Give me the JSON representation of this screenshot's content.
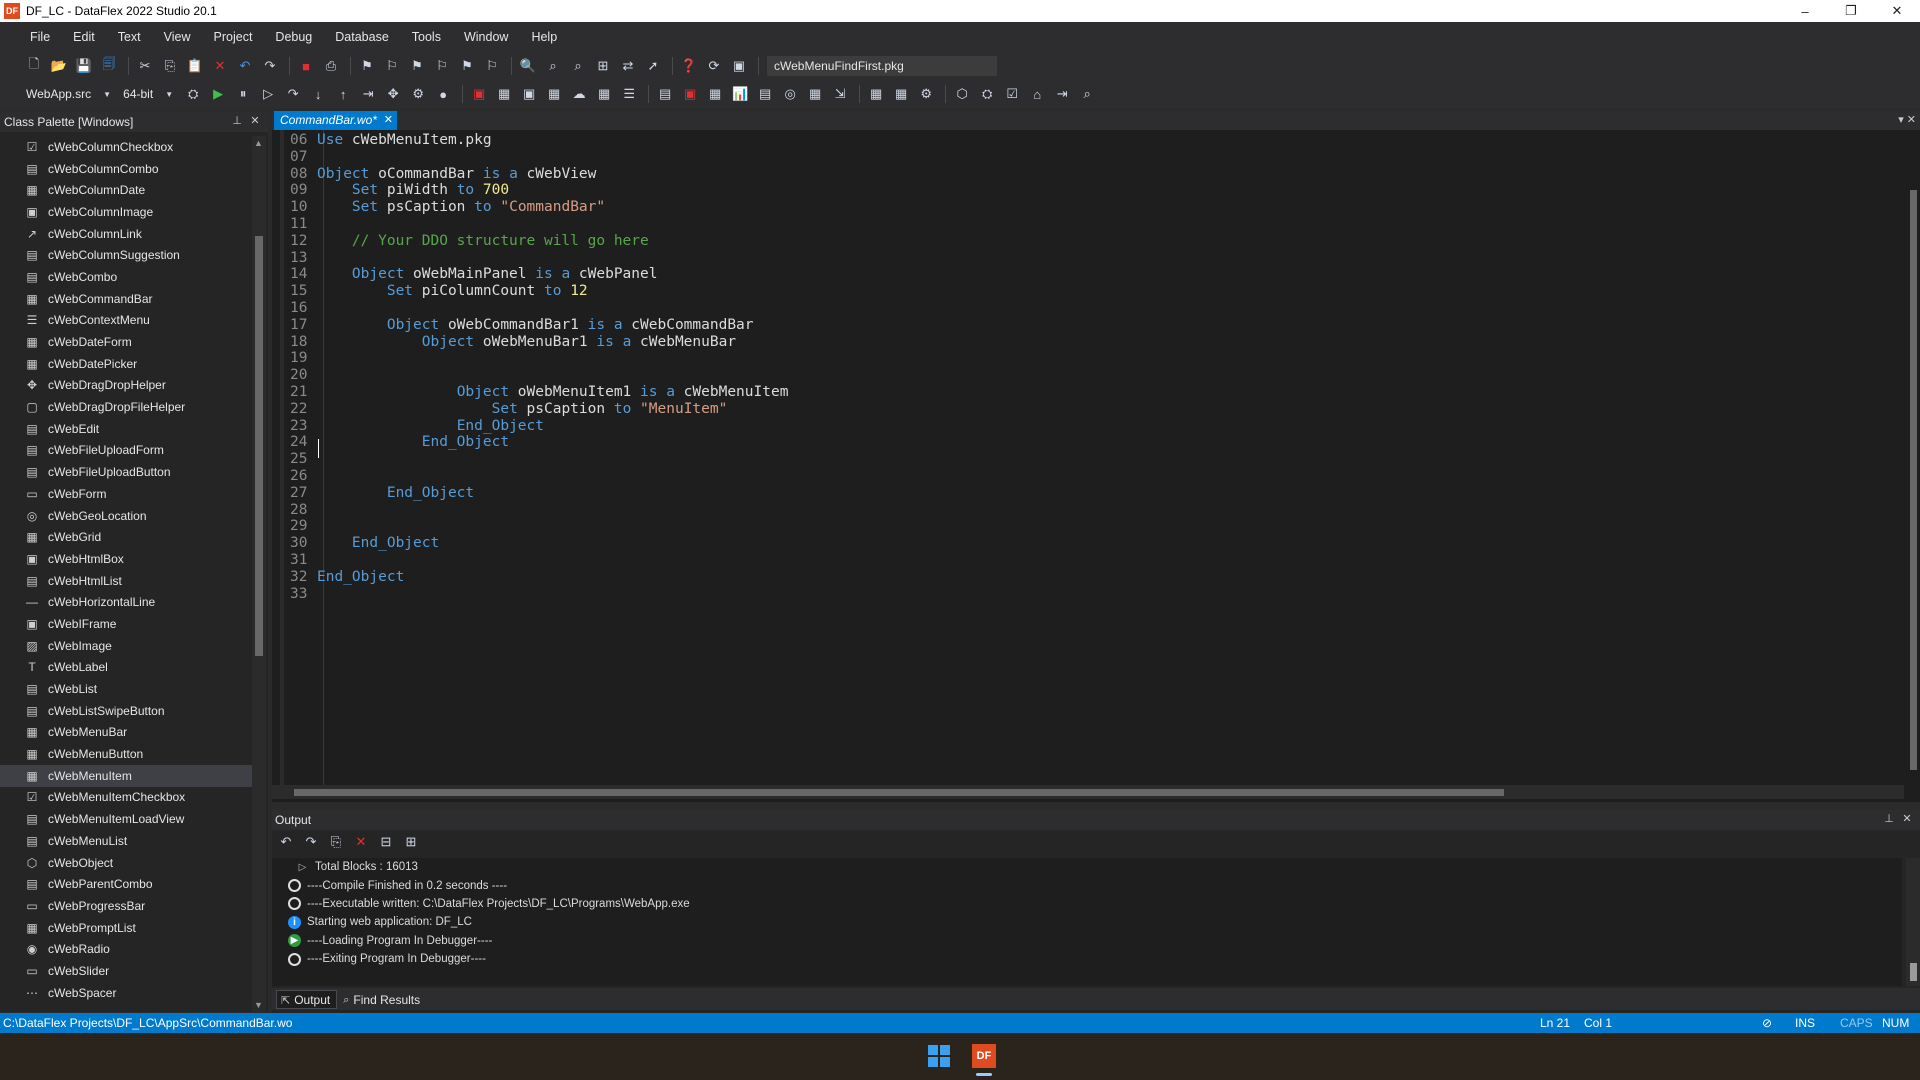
{
  "window": {
    "title": "DF_LC - DataFlex 2022 Studio 20.1",
    "app_icon": "DF",
    "controls": {
      "minimize": "–",
      "maximize": "❐",
      "close": "✕"
    }
  },
  "menu": [
    "File",
    "Edit",
    "Text",
    "View",
    "Project",
    "Debug",
    "Database",
    "Tools",
    "Window",
    "Help"
  ],
  "toolbar": {
    "search_combo_value": "cWebMenuFindFirst.pkg",
    "project_selector": "WebApp.src",
    "bitness_selector": "64-bit"
  },
  "class_palette": {
    "title": "Class Palette [Windows]",
    "selected_index": 29,
    "items": [
      {
        "label": "cWebColumnCheckbox",
        "icon": "☑"
      },
      {
        "label": "cWebColumnCombo",
        "icon": "▤"
      },
      {
        "label": "cWebColumnDate",
        "icon": "▦"
      },
      {
        "label": "cWebColumnImage",
        "icon": "▣"
      },
      {
        "label": "cWebColumnLink",
        "icon": "↗"
      },
      {
        "label": "cWebColumnSuggestion",
        "icon": "▤"
      },
      {
        "label": "cWebCombo",
        "icon": "▤"
      },
      {
        "label": "cWebCommandBar",
        "icon": "▦"
      },
      {
        "label": "cWebContextMenu",
        "icon": "☰"
      },
      {
        "label": "cWebDateForm",
        "icon": "▦"
      },
      {
        "label": "cWebDatePicker",
        "icon": "▦"
      },
      {
        "label": "cWebDragDropHelper",
        "icon": "✥"
      },
      {
        "label": "cWebDragDropFileHelper",
        "icon": "▢"
      },
      {
        "label": "cWebEdit",
        "icon": "▤"
      },
      {
        "label": "cWebFileUploadForm",
        "icon": "▤"
      },
      {
        "label": "cWebFileUploadButton",
        "icon": "▤"
      },
      {
        "label": "cWebForm",
        "icon": "▭"
      },
      {
        "label": "cWebGeoLocation",
        "icon": "◎"
      },
      {
        "label": "cWebGrid",
        "icon": "▦"
      },
      {
        "label": "cWebHtmlBox",
        "icon": "▣"
      },
      {
        "label": "cWebHtmlList",
        "icon": "▤"
      },
      {
        "label": "cWebHorizontalLine",
        "icon": "—"
      },
      {
        "label": "cWebIFrame",
        "icon": "▣"
      },
      {
        "label": "cWebImage",
        "icon": "▨"
      },
      {
        "label": "cWebLabel",
        "icon": "T"
      },
      {
        "label": "cWebList",
        "icon": "▤"
      },
      {
        "label": "cWebListSwipeButton",
        "icon": "▤"
      },
      {
        "label": "cWebMenuBar",
        "icon": "▦"
      },
      {
        "label": "cWebMenuButton",
        "icon": "▦"
      },
      {
        "label": "cWebMenuItem",
        "icon": "▦"
      },
      {
        "label": "cWebMenuItemCheckbox",
        "icon": "☑"
      },
      {
        "label": "cWebMenuItemLoadView",
        "icon": "▤"
      },
      {
        "label": "cWebMenuList",
        "icon": "▤"
      },
      {
        "label": "cWebObject",
        "icon": "⬡"
      },
      {
        "label": "cWebParentCombo",
        "icon": "▤"
      },
      {
        "label": "cWebProgressBar",
        "icon": "▭"
      },
      {
        "label": "cWebPromptList",
        "icon": "▦"
      },
      {
        "label": "cWebRadio",
        "icon": "◉"
      },
      {
        "label": "cWebSlider",
        "icon": "▭"
      },
      {
        "label": "cWebSpacer",
        "icon": "⋯"
      }
    ]
  },
  "editor": {
    "tab_label": "CommandBar.wo*",
    "lines": [
      {
        "n": "06",
        "segs": [
          [
            "kw",
            "Use "
          ],
          [
            "",
            "cWebMenuItem.pkg"
          ]
        ]
      },
      {
        "n": "07",
        "segs": []
      },
      {
        "n": "08",
        "segs": [
          [
            "kw",
            "Object "
          ],
          [
            "",
            "oCommandBar "
          ],
          [
            "kw",
            "is a "
          ],
          [
            "",
            "cWebView"
          ]
        ]
      },
      {
        "n": "09",
        "segs": [
          [
            "",
            "    "
          ],
          [
            "kw",
            "Set "
          ],
          [
            "",
            "piWidth "
          ],
          [
            "kw",
            "to "
          ],
          [
            "num",
            "700"
          ]
        ]
      },
      {
        "n": "10",
        "segs": [
          [
            "",
            "    "
          ],
          [
            "kw",
            "Set "
          ],
          [
            "",
            "psCaption "
          ],
          [
            "kw",
            "to "
          ],
          [
            "str",
            "\"CommandBar\""
          ]
        ]
      },
      {
        "n": "11",
        "segs": []
      },
      {
        "n": "12",
        "segs": [
          [
            "",
            "    "
          ],
          [
            "com",
            "// Your DDO structure will go here"
          ]
        ]
      },
      {
        "n": "13",
        "segs": []
      },
      {
        "n": "14",
        "segs": [
          [
            "",
            "    "
          ],
          [
            "kw",
            "Object "
          ],
          [
            "",
            "oWebMainPanel "
          ],
          [
            "kw",
            "is a "
          ],
          [
            "",
            "cWebPanel"
          ]
        ]
      },
      {
        "n": "15",
        "segs": [
          [
            "",
            "        "
          ],
          [
            "kw",
            "Set "
          ],
          [
            "",
            "piColumnCount "
          ],
          [
            "kw",
            "to "
          ],
          [
            "num",
            "12"
          ]
        ]
      },
      {
        "n": "16",
        "segs": []
      },
      {
        "n": "17",
        "segs": [
          [
            "",
            "        "
          ],
          [
            "kw",
            "Object "
          ],
          [
            "",
            "oWebCommandBar1 "
          ],
          [
            "kw",
            "is a "
          ],
          [
            "",
            "cWebCommandBar"
          ]
        ]
      },
      {
        "n": "18",
        "segs": [
          [
            "",
            "            "
          ],
          [
            "kw",
            "Object "
          ],
          [
            "",
            "oWebMenuBar1 "
          ],
          [
            "kw",
            "is a "
          ],
          [
            "",
            "cWebMenuBar"
          ]
        ]
      },
      {
        "n": "19",
        "segs": []
      },
      {
        "n": "20",
        "segs": []
      },
      {
        "n": "21",
        "segs": [
          [
            "",
            "                "
          ],
          [
            "kw",
            "Object "
          ],
          [
            "",
            "oWebMenuItem1 "
          ],
          [
            "kw",
            "is a "
          ],
          [
            "",
            "cWebMenuItem"
          ]
        ]
      },
      {
        "n": "22",
        "segs": [
          [
            "",
            "                    "
          ],
          [
            "kw",
            "Set "
          ],
          [
            "",
            "psCaption "
          ],
          [
            "kw",
            "to "
          ],
          [
            "str",
            "\"MenuItem\""
          ]
        ]
      },
      {
        "n": "23",
        "segs": [
          [
            "",
            "                "
          ],
          [
            "kw",
            "End_Object"
          ]
        ]
      },
      {
        "n": "24",
        "segs": [
          [
            "",
            "            "
          ],
          [
            "kw",
            "End_Object"
          ]
        ]
      },
      {
        "n": "25",
        "segs": []
      },
      {
        "n": "26",
        "segs": []
      },
      {
        "n": "27",
        "segs": [
          [
            "",
            "        "
          ],
          [
            "kw",
            "End_Object"
          ]
        ]
      },
      {
        "n": "28",
        "segs": []
      },
      {
        "n": "29",
        "segs": []
      },
      {
        "n": "30",
        "segs": [
          [
            "",
            "    "
          ],
          [
            "kw",
            "End_Object"
          ]
        ]
      },
      {
        "n": "31",
        "segs": []
      },
      {
        "n": "32",
        "segs": [
          [
            "kw",
            "End_Object"
          ]
        ]
      },
      {
        "n": "33",
        "segs": []
      }
    ]
  },
  "output": {
    "title": "Output",
    "lines": [
      {
        "icon": "tri",
        "text": "Total Blocks    : 16013"
      },
      {
        "icon": "circ",
        "text": "----Compile Finished in 0.2 seconds ----"
      },
      {
        "icon": "circ",
        "text": "----Executable written: C:\\DataFlex Projects\\DF_LC\\Programs\\WebApp.exe"
      },
      {
        "icon": "info",
        "text": "Starting web application: DF_LC"
      },
      {
        "icon": "play",
        "text": "----Loading Program In Debugger----"
      },
      {
        "icon": "circ",
        "text": "----Exiting Program In Debugger----"
      }
    ],
    "tabs": [
      "Output",
      "Find Results"
    ]
  },
  "status": {
    "path": "C:\\DataFlex Projects\\DF_LC\\AppSrc\\CommandBar.wo",
    "line": "Ln 21",
    "col": "Col 1",
    "ins": "INS",
    "caps": "CAPS",
    "num": "NUM"
  },
  "taskbar": {
    "app_icon": "DF"
  }
}
